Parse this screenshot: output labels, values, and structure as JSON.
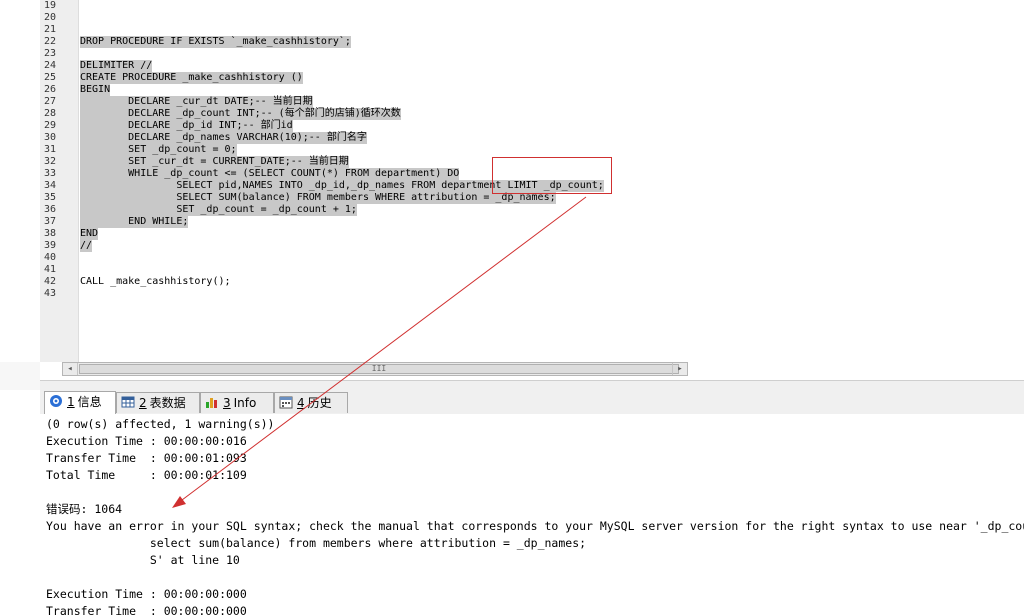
{
  "editor": {
    "line_numbers": [
      "19",
      "20",
      "21",
      "22",
      "23",
      "24",
      "25",
      "26",
      "27",
      "28",
      "29",
      "30",
      "31",
      "32",
      "33",
      "34",
      "35",
      "36",
      "37",
      "38",
      "39",
      "40",
      "41",
      "42",
      "43"
    ],
    "lines": [
      "",
      "",
      "",
      "DROP PROCEDURE IF EXISTS `_make_cashhistory`;",
      "",
      "DELIMITER //",
      "CREATE PROCEDURE _make_cashhistory ()",
      "BEGIN",
      "        DECLARE _cur_dt DATE;-- 当前日期",
      "        DECLARE _dp_count INT;-- (每个部门的店铺)循环次数",
      "        DECLARE _dp_id INT;-- 部门id",
      "        DECLARE _dp_names VARCHAR(10);-- 部门名字",
      "        SET _dp_count = 0;",
      "        SET _cur_dt = CURRENT_DATE;-- 当前日期",
      "        WHILE _dp_count <= (SELECT COUNT(*) FROM department) DO",
      "                SELECT pid,NAMES INTO _dp_id,_dp_names FROM department LIMIT _dp_count;",
      "                SELECT SUM(balance) FROM members WHERE attribution = _dp_names;",
      "                SET _dp_count = _dp_count + 1;",
      "        END WHILE;",
      "END",
      "//",
      "",
      "",
      "CALL _make_cashhistory();",
      ""
    ]
  },
  "scrollbar": {
    "thumb_grip": "III"
  },
  "tabs": [
    {
      "num": "1",
      "label": "信息",
      "icon": "info-icon"
    },
    {
      "num": "2",
      "label": "表数据",
      "icon": "table-icon"
    },
    {
      "num": "3",
      "label": "Info",
      "icon": "chart-icon"
    },
    {
      "num": "4",
      "label": "历史",
      "icon": "calendar-icon"
    }
  ],
  "output": {
    "lines": [
      "(0 row(s) affected, 1 warning(s))",
      "Execution Time : 00:00:00:016",
      "Transfer Time  : 00:00:01:093",
      "Total Time     : 00:00:01:109",
      "",
      "错误码: 1064",
      "You have an error in your SQL syntax; check the manual that corresponds to your MySQL server version for the right syntax to use near '_dp_count;",
      "               select sum(balance) from members where attribution = _dp_names;",
      "               S' at line 10",
      "",
      "Execution Time : 00:00:00:000",
      "Transfer Time  : 00:00:00:000"
    ]
  },
  "colors": {
    "keyword": "#3a3ae0",
    "comment": "#2f7f2f",
    "function": "#e040e0",
    "selection": "#c8c8c8",
    "annotation": "#d03030"
  }
}
